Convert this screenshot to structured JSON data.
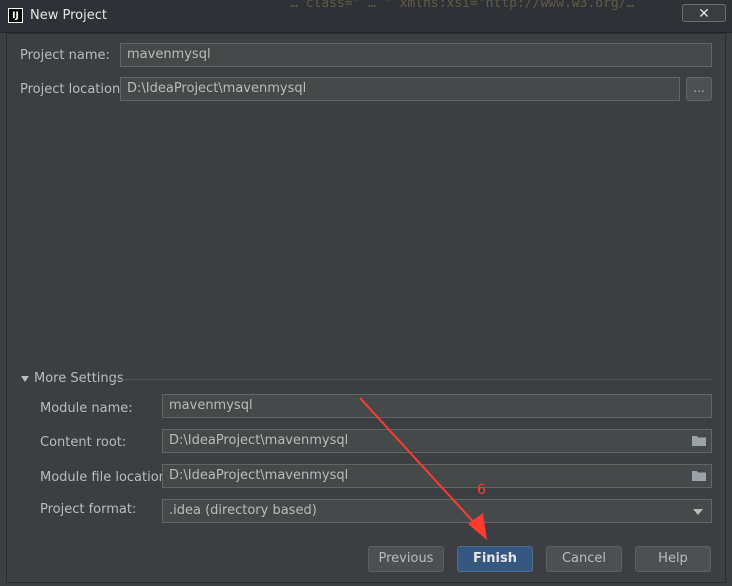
{
  "window": {
    "title": "New Project",
    "app_icon_text": "IJ",
    "close_symbol": "✕",
    "background_code": "…  class=\"   …  \"   xmlns:xsi=\"http://www.w3.org/…"
  },
  "project": {
    "name_label": "Project name:",
    "name_value": "mavenmysql",
    "location_label": "Project location:",
    "location_value": "D:\\IdeaProject\\mavenmysql",
    "browse_label": "..."
  },
  "more_settings": {
    "header": "More Settings",
    "module_name_label": "Module name:",
    "module_name_value": "mavenmysql",
    "content_root_label": "Content root:",
    "content_root_value": "D:\\IdeaProject\\mavenmysql",
    "module_file_label": "Module file location:",
    "module_file_value": "D:\\IdeaProject\\mavenmysql",
    "project_format_label": "Project format:",
    "project_format_value": ".idea (directory based)"
  },
  "buttons": {
    "previous": "Previous",
    "finish": "Finish",
    "cancel": "Cancel",
    "help": "Help"
  },
  "annotation": {
    "step_number": "6",
    "color": "#ff3b30"
  },
  "colors": {
    "dialog_bg": "#3c3f41",
    "field_bg": "#45494a",
    "primary_button": "#365880"
  }
}
